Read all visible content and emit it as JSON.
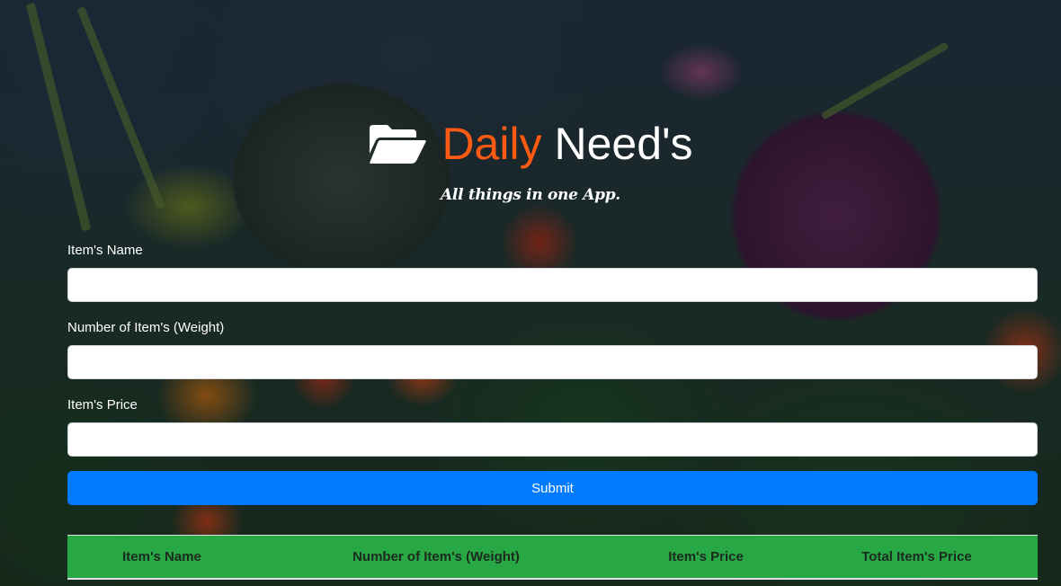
{
  "header": {
    "title_part1": "Daily",
    "title_part2": "Need's",
    "tagline": "All things in one App.",
    "icon": "folder-open-icon",
    "accent_color": "#ff5a12"
  },
  "form": {
    "fields": [
      {
        "label": "Item's Name",
        "value": "",
        "placeholder": ""
      },
      {
        "label": "Number of Item's (Weight)",
        "value": "",
        "placeholder": ""
      },
      {
        "label": "Item's Price",
        "value": "",
        "placeholder": ""
      }
    ],
    "submit_label": "Submit",
    "submit_color": "#007bff"
  },
  "table": {
    "header_color": "#28a745",
    "columns": [
      "Item's Name",
      "Number of Item's (Weight)",
      "Item's Price",
      "Total Item's Price"
    ]
  }
}
